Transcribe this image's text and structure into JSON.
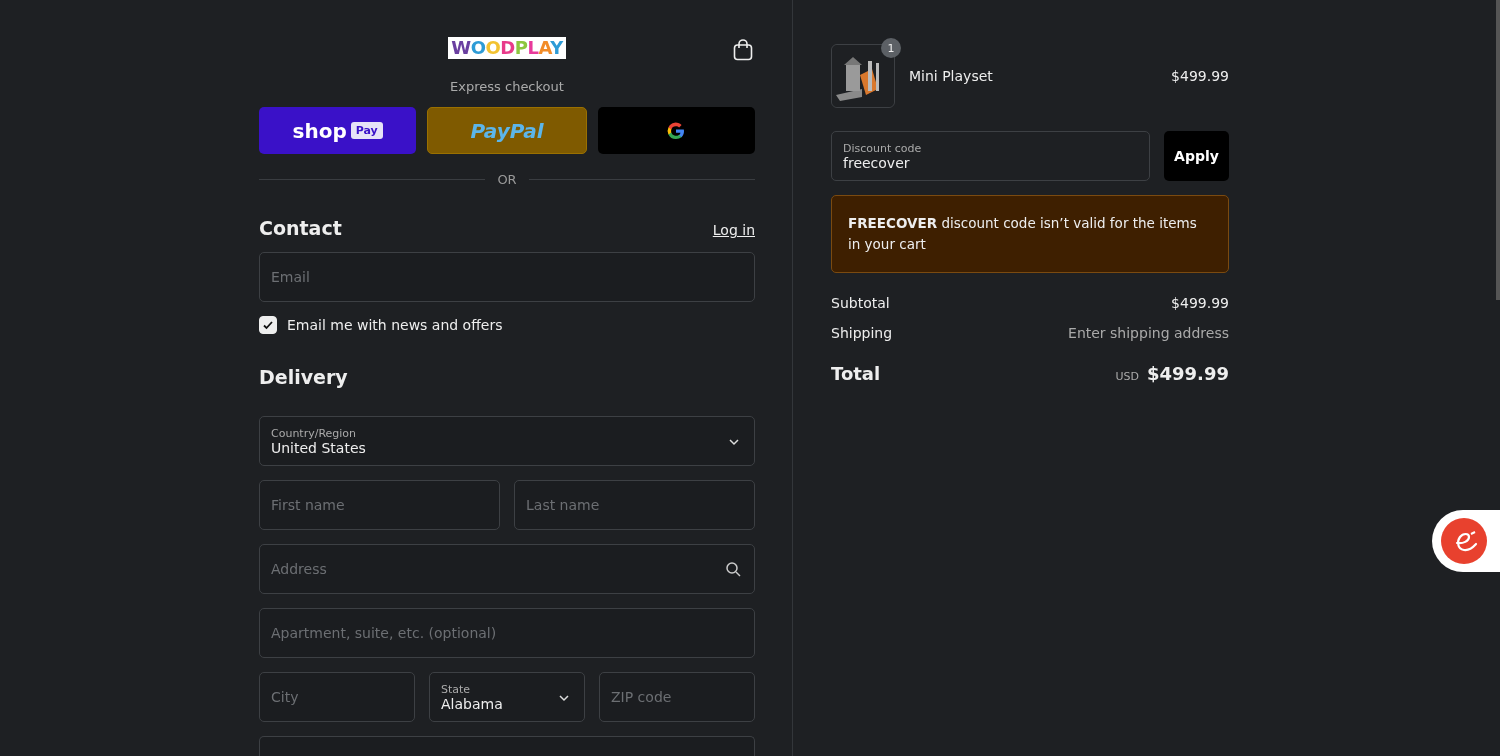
{
  "header": {
    "logo": "WOODPLAY"
  },
  "express": {
    "title": "Express checkout",
    "buttons": [
      {
        "kind": "shop",
        "label": "shop",
        "badge": "Pay"
      },
      {
        "kind": "paypal",
        "label": "PayPal"
      },
      {
        "kind": "google"
      }
    ],
    "separator": "OR"
  },
  "contact": {
    "title": "Contact",
    "login": "Log in",
    "email": {
      "placeholder": "Email"
    },
    "newsletter": {
      "label": "Email me with news and offers",
      "checked": true
    }
  },
  "delivery": {
    "title": "Delivery",
    "rows": [
      [
        {
          "kind": "select",
          "label": "Country/Region",
          "value": "United States"
        }
      ],
      [
        {
          "kind": "text",
          "placeholder": "First name"
        },
        {
          "kind": "text",
          "placeholder": "Last name"
        }
      ],
      [
        {
          "kind": "search",
          "placeholder": "Address"
        }
      ],
      [
        {
          "kind": "text",
          "placeholder": "Apartment, suite, etc. (optional)"
        }
      ],
      [
        {
          "kind": "text",
          "placeholder": "City"
        },
        {
          "kind": "select",
          "label": "State",
          "value": "Alabama"
        },
        {
          "kind": "text",
          "placeholder": "ZIP code"
        }
      ]
    ]
  },
  "summary": {
    "items": [
      {
        "name": "Mini Playset",
        "quantity": "1",
        "price": "$499.99"
      }
    ],
    "discount": {
      "label": "Discount code",
      "value": "freecover",
      "button": "Apply"
    },
    "error": "**FREECOVER** discount code isn’t valid for the items in your cart",
    "lines": [
      {
        "label": "Subtotal",
        "value": "$499.99",
        "muted": false
      },
      {
        "label": "Shipping",
        "value": "Enter shipping address",
        "muted": true
      }
    ],
    "total": {
      "label": "Total",
      "currency": "USD",
      "value": "$499.99"
    }
  }
}
